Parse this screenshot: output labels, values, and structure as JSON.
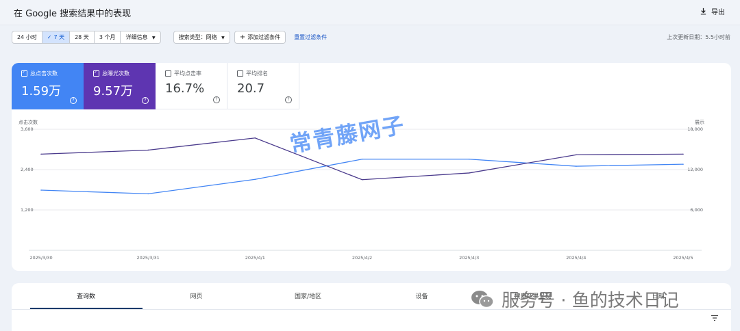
{
  "header": {
    "title": "在 Google 搜索结果中的表现",
    "export_label": "导出"
  },
  "filters": {
    "date_ranges": [
      "24 小时",
      "7 天",
      "28 天",
      "3 个月"
    ],
    "active_range": "7 天",
    "more_label": "详细信息",
    "search_type": "搜索类型：网络",
    "add_filter": "添加过滤条件",
    "reset": "重置过滤条件",
    "updated": "上次更新日期：5.5小时前"
  },
  "metrics": [
    {
      "label": "总点击次数",
      "value": "1.59万",
      "selected": true,
      "color": "#4285f4"
    },
    {
      "label": "总曝光次数",
      "value": "9.57万",
      "selected": true,
      "color": "#5e35b1"
    },
    {
      "label": "平均点击率",
      "value": "16.7%",
      "selected": false
    },
    {
      "label": "平均排名",
      "value": "20.7",
      "selected": false
    }
  ],
  "chart_data": {
    "type": "line",
    "x": [
      "2025/3/30",
      "2025/3/31",
      "2025/4/1",
      "2025/4/2",
      "2025/4/3",
      "2025/4/4",
      "2025/4/5"
    ],
    "y_left_label": "点击次数",
    "y_left_ticks": [
      "3,600",
      "2,400",
      "1,200"
    ],
    "y_left_range": [
      0,
      3600
    ],
    "y_right_label": "展示",
    "y_right_ticks": [
      "18,000",
      "12,000",
      "6,000"
    ],
    "y_right_range": [
      0,
      18000
    ],
    "series": [
      {
        "color": "#4285f4",
        "axis": "left",
        "values": [
          1790,
          1680,
          2110,
          2710,
          2710,
          2500,
          2560
        ]
      },
      {
        "color": "#4a3a8c",
        "axis": "right",
        "values": [
          14300,
          14900,
          16700,
          10500,
          11500,
          14200,
          14300
        ]
      }
    ]
  },
  "watermark": "常青藤网子",
  "tabs": [
    "查询数",
    "网页",
    "国家/地区",
    "设备",
    "搜索结果呈现",
    "日期"
  ],
  "active_tab": "查询数",
  "overlay_text": "服务号 · 鱼的技术日记"
}
